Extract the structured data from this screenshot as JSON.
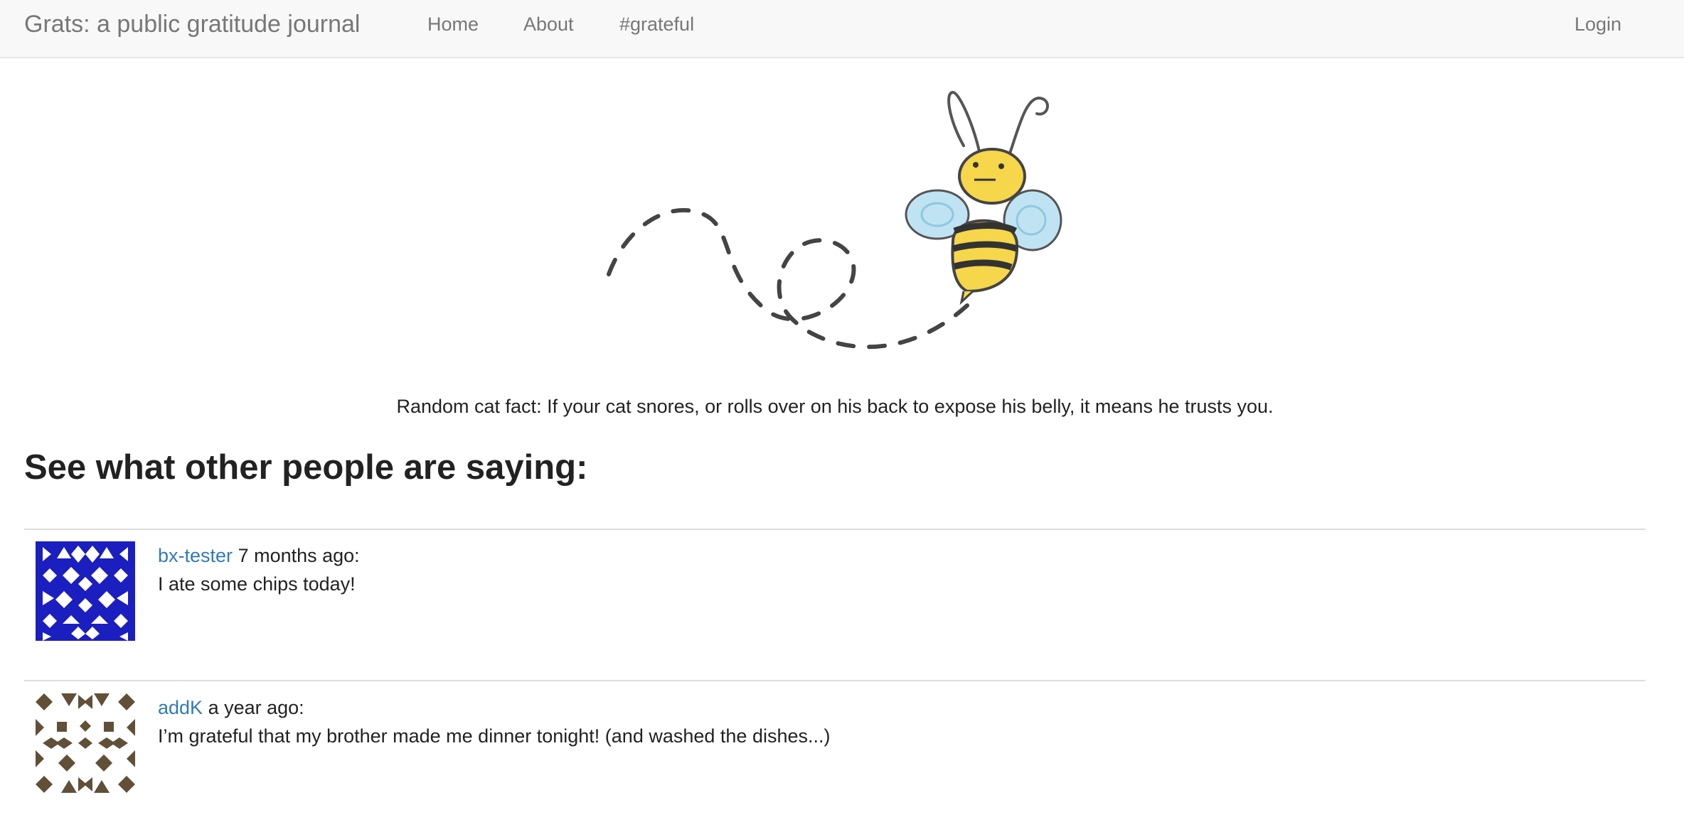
{
  "nav": {
    "brand": "Grats: a public gratitude journal",
    "links": [
      "Home",
      "About",
      "#grateful"
    ],
    "login": "Login"
  },
  "hero": {
    "image": "bee-flying-icon",
    "cat_fact": "Random cat fact: If your cat snores, or rolls over on his back to expose his belly, it means he trusts you."
  },
  "feed": {
    "heading": "See what other people are saying:",
    "posts": [
      {
        "username": "bx-tester",
        "time": "7 months ago:",
        "text": "I ate some chips today!",
        "avatar_color": "#1b1fbf"
      },
      {
        "username": "addK",
        "time": "a year ago:",
        "text": "I’m grateful that my brother made me dinner tonight! (and washed the dishes...)",
        "avatar_color": "#614f38"
      }
    ]
  },
  "colors": {
    "link": "#337ab7",
    "navbar_bg": "#f8f8f8",
    "bee_yellow": "#f6d64a",
    "wing_blue": "#bfe3f2"
  }
}
